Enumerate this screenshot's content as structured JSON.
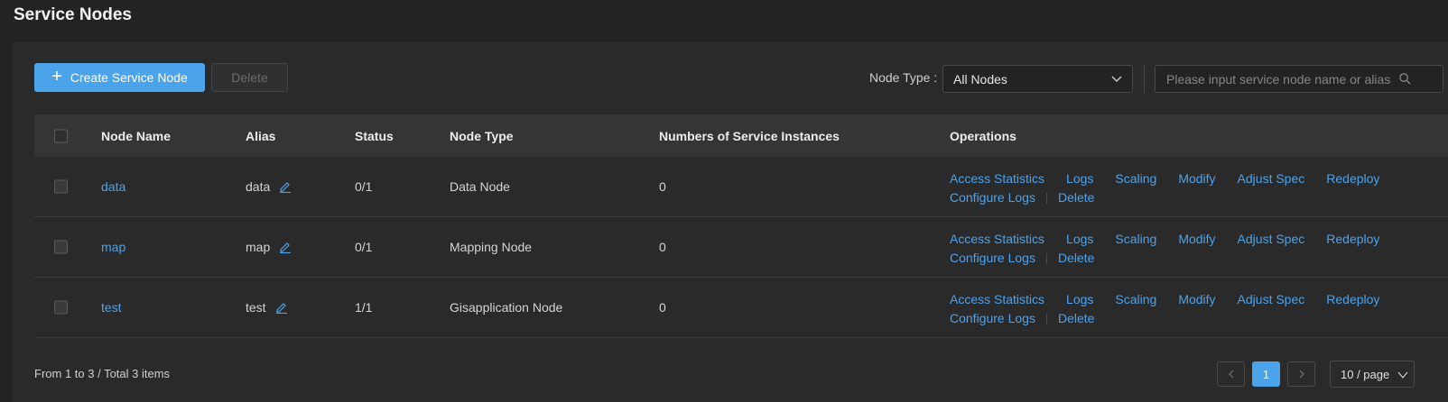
{
  "page": {
    "title": "Service Nodes"
  },
  "toolbar": {
    "create_label": "Create Service Node",
    "delete_label": "Delete",
    "node_type_label": "Node Type :",
    "node_type_value": "All Nodes",
    "search_placeholder": "Please input service node name or alias"
  },
  "table": {
    "columns": [
      "Node Name",
      "Alias",
      "Status",
      "Node Type",
      "Numbers of Service Instances",
      "Operations"
    ],
    "rows": [
      {
        "name": "data",
        "alias": "data",
        "status": "0/1",
        "type": "Data Node",
        "instances": "0"
      },
      {
        "name": "map",
        "alias": "map",
        "status": "0/1",
        "type": "Mapping Node",
        "instances": "0"
      },
      {
        "name": "test",
        "alias": "test",
        "status": "1/1",
        "type": "Gisapplication Node",
        "instances": "0"
      }
    ],
    "operations": [
      "Access Statistics",
      "Logs",
      "Scaling",
      "Modify",
      "Adjust Spec",
      "Redeploy",
      "Configure Logs",
      "Delete"
    ]
  },
  "footer": {
    "summary": "From 1 to 3 / Total 3 items",
    "current_page": "1",
    "page_size": "10 / page"
  },
  "colors": {
    "accent": "#4ba3e9",
    "link": "#4aa3ef",
    "background": "#232323",
    "panel": "#2a2a2a"
  },
  "icons": [
    "plus-icon",
    "chevron-down-icon",
    "search-icon",
    "edit-pencil-icon",
    "chevron-left-icon",
    "chevron-right-icon"
  ]
}
